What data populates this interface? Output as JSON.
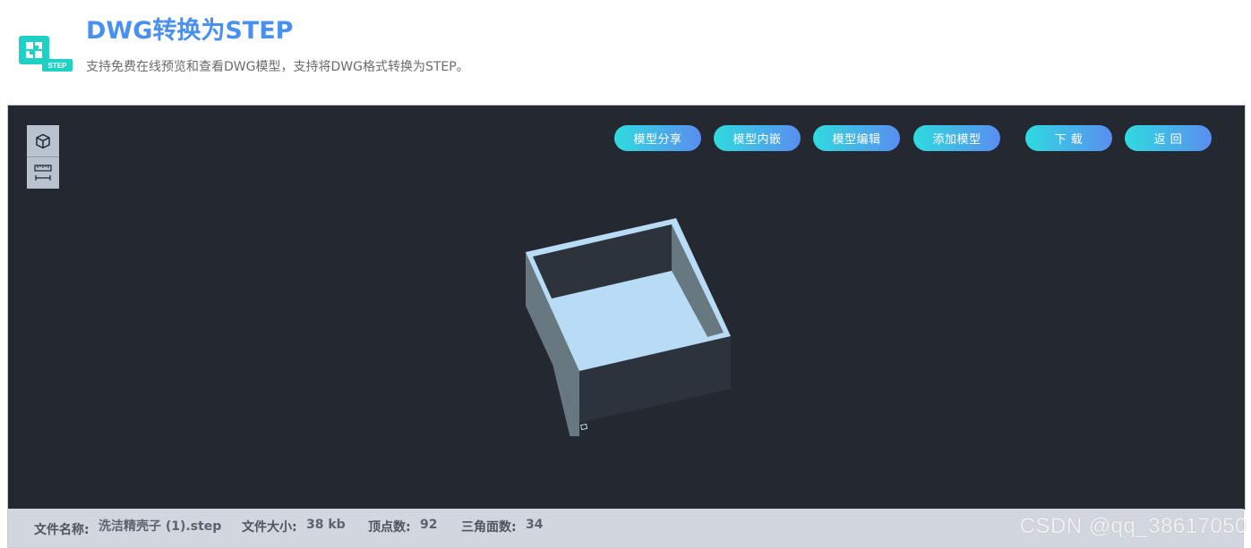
{
  "header": {
    "title": "DWG转换为STEP",
    "subtitle": "支持免费在线预览和查看DWG模型，支持将DWG格式转换为STEP。",
    "logo_badge": "STEP"
  },
  "toolbar": {
    "tools": [
      {
        "icon": "cube-icon"
      },
      {
        "icon": "ruler-icon"
      }
    ]
  },
  "actions": {
    "share": "模型分享",
    "embed": "模型内嵌",
    "edit": "模型编辑",
    "add": "添加模型",
    "download": "下 载",
    "back": "返 回"
  },
  "status": {
    "file_name_label": "文件名称:",
    "file_name": "洗洁精壳子 (1).step",
    "file_size_label": "文件大小:",
    "file_size": "38 kb",
    "vertices_label": "顶点数:",
    "vertices": "92",
    "triangles_label": "三角面数:",
    "triangles": "34"
  },
  "watermark": "CSDN @qq_38617050",
  "colors": {
    "title": "#4a90f0",
    "viewer_bg": "#232831",
    "button_gradient_start": "#2fdbe0",
    "button_gradient_end": "#5a8df0",
    "model_light": "#b8dcf6",
    "model_side": "#687880",
    "model_dark": "#2d333c"
  }
}
